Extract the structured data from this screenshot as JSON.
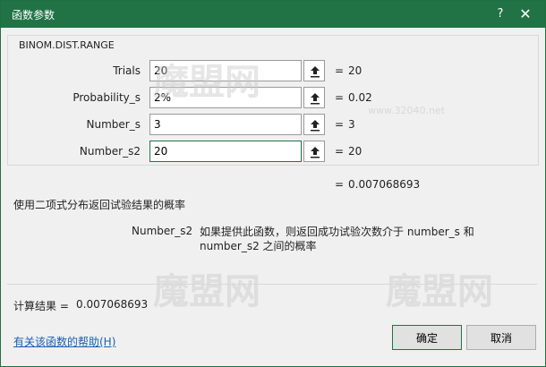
{
  "window": {
    "title": "函数参数",
    "help_glyph": "?",
    "close_glyph": "✕"
  },
  "function_name": "BINOM.DIST.RANGE",
  "arguments": [
    {
      "label": "Trials",
      "value": "20",
      "result": "20"
    },
    {
      "label": "Probability_s",
      "value": "2%",
      "result": "0.02"
    },
    {
      "label": "Number_s",
      "value": "3",
      "result": "3"
    },
    {
      "label": "Number_s2",
      "value": "20",
      "result": "20"
    }
  ],
  "equals": "=",
  "formula_result": "0.007068693",
  "description": "使用二项式分布返回试验结果的概率",
  "arg_help": {
    "name": "Number_s2",
    "text": "如果提供此函数，则返回成功试验次数介于 number_s 和 number_s2 之间的概率"
  },
  "calc": {
    "label": "计算结果 =",
    "value": "0.007068693"
  },
  "help_link": "有关该函数的帮助(H)",
  "buttons": {
    "ok": "确定",
    "cancel": "取消"
  },
  "watermark": {
    "brand": "魔盟网",
    "url": "www.32040.net"
  },
  "colors": {
    "titlebar": "#217346",
    "link": "#1a5fb4"
  },
  "icons": {
    "ref_button": "collapse-dialog-arrow-icon"
  }
}
